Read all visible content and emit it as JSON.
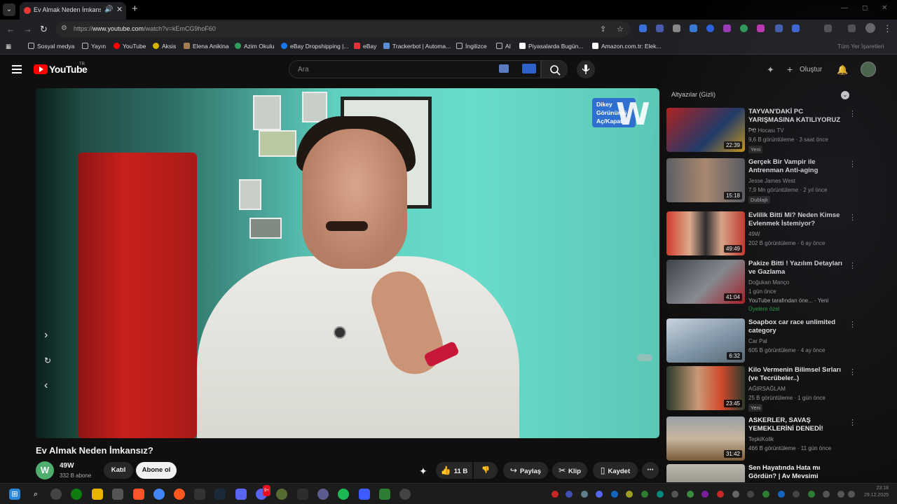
{
  "browser": {
    "tab_title": "Ev Almak Neden İmkansız?",
    "url_prefix": "https://",
    "url_host": "www.youtube.com",
    "url_path": "/watch?v=kEmCG9hoF60",
    "bookmarks": [
      {
        "label": "Sosyal medya",
        "icon": "folder-icon",
        "color": "#bbbbbb"
      },
      {
        "label": "Yayın",
        "icon": "folder-icon",
        "color": "#bbbbbb"
      },
      {
        "label": "YouTube",
        "icon": "youtube-icon",
        "color": "#ff0000"
      },
      {
        "label": "Aksis",
        "icon": "aksis-icon",
        "color": "#d4b400"
      },
      {
        "label": "Elena Anikina",
        "icon": "image-icon",
        "color": "#a67c52"
      },
      {
        "label": "Azim Okulu",
        "icon": "azim-icon",
        "color": "#2e9e5b"
      },
      {
        "label": "eBay Dropshipping |...",
        "icon": "facebook-icon",
        "color": "#1877f2"
      },
      {
        "label": "eBay",
        "icon": "ebay-icon",
        "color": "#e53238"
      },
      {
        "label": "Trackerbot | Automa...",
        "icon": "trackerbot-icon",
        "color": "#5a8fd6"
      },
      {
        "label": "İngilizce",
        "icon": "folder-icon",
        "color": "#bbbbbb"
      },
      {
        "label": "AI",
        "icon": "folder-icon",
        "color": "#bbbbbb"
      },
      {
        "label": "Piyasalarda Bugün...",
        "icon": "news-icon",
        "color": "#ffffff"
      },
      {
        "label": "Amazon.com.tr: Elek...",
        "icon": "amazon-icon",
        "color": "#ffffff"
      }
    ],
    "all_bookmarks": "Tüm Yer İşaretleri"
  },
  "masthead": {
    "logo": "YouTube",
    "country": "TR",
    "search_placeholder": "Ara",
    "create_label": "Oluştur"
  },
  "video": {
    "title": "Ev Almak Neden İmkansız?",
    "overlay_badge": [
      "Dikey",
      "Görünümü",
      "Aç/Kapat"
    ],
    "channel_name": "49W",
    "channel_initial": "W",
    "subscribers": "332 B abone",
    "join_label": "Katıl",
    "subscribe_label": "Abone ol",
    "likes": "11 B",
    "share_label": "Paylaş",
    "clip_label": "Klip",
    "save_label": "Kaydet"
  },
  "sidebar": {
    "header": "Altyazılar (Gizli)",
    "items": [
      {
        "title": "TAYVAN'DAKİ PC YARIŞMASINA KATILIYORUZ -...",
        "channel": "PC Hocası TV",
        "meta": "9,6 B görüntüleme · 3 saat önce",
        "badge": "Yeni",
        "duration": "22:39",
        "color": "#1e3a6b"
      },
      {
        "title": "Gerçek Bir Vampir ile Antrenman Anti-aging",
        "channel": "Jesse James West",
        "meta": "7,9 Mn görüntüleme · 2 yıl önce",
        "badge": "Dublajlı",
        "duration": "15:18",
        "color": "#6b6f73"
      },
      {
        "title": "Evlilik Bitti Mi? Neden Kimse Evlenmek İstemiyor?",
        "channel": "49W",
        "meta": "202 B görüntüleme · 6 ay önce",
        "badge": "",
        "duration": "49:49",
        "color": "#c0392b"
      },
      {
        "title": "Pakize Bitti ! Yazılım Detayları ve Gazlama",
        "channel": "Doğukan Manço",
        "meta": "1 gün önce",
        "badge": "YouTube tarafından öne... · Yeni",
        "badge2": "Üyelere özel",
        "duration": "41:04",
        "color": "#4a4f57"
      },
      {
        "title": "Soapbox car race unlimited category",
        "channel": "Car Pal",
        "meta": "605 B görüntüleme · 4 ay önce",
        "badge": "",
        "duration": "6:32",
        "color": "#8aa1b5"
      },
      {
        "title": "Kilo Vermenin Bilimsel Sırları (ve Tecrübeler..)",
        "channel": "AĞIRSAĞLAM",
        "meta": "25 B görüntüleme · 1 gün önce",
        "badge": "Yeni",
        "duration": "23:45",
        "color": "#3b4d3a"
      },
      {
        "title": "ASKERLER, SAVAŞ YEMEKLERİNİ DENEDİ!",
        "channel": "TepkiKolik",
        "meta": "466 B görüntüleme · 11 gün önce",
        "badge": "",
        "duration": "31:42",
        "color": "#7a6b55"
      },
      {
        "title": "Sen Hayatında Hata mı Gördün? | Av Mevsimi",
        "channel": "",
        "meta": "",
        "badge": "",
        "duration": "",
        "color": "#8c8a84"
      }
    ]
  },
  "taskbar": {
    "clock_time": "23:18",
    "clock_date": "29.12.2025",
    "discord_badge": "9+"
  }
}
